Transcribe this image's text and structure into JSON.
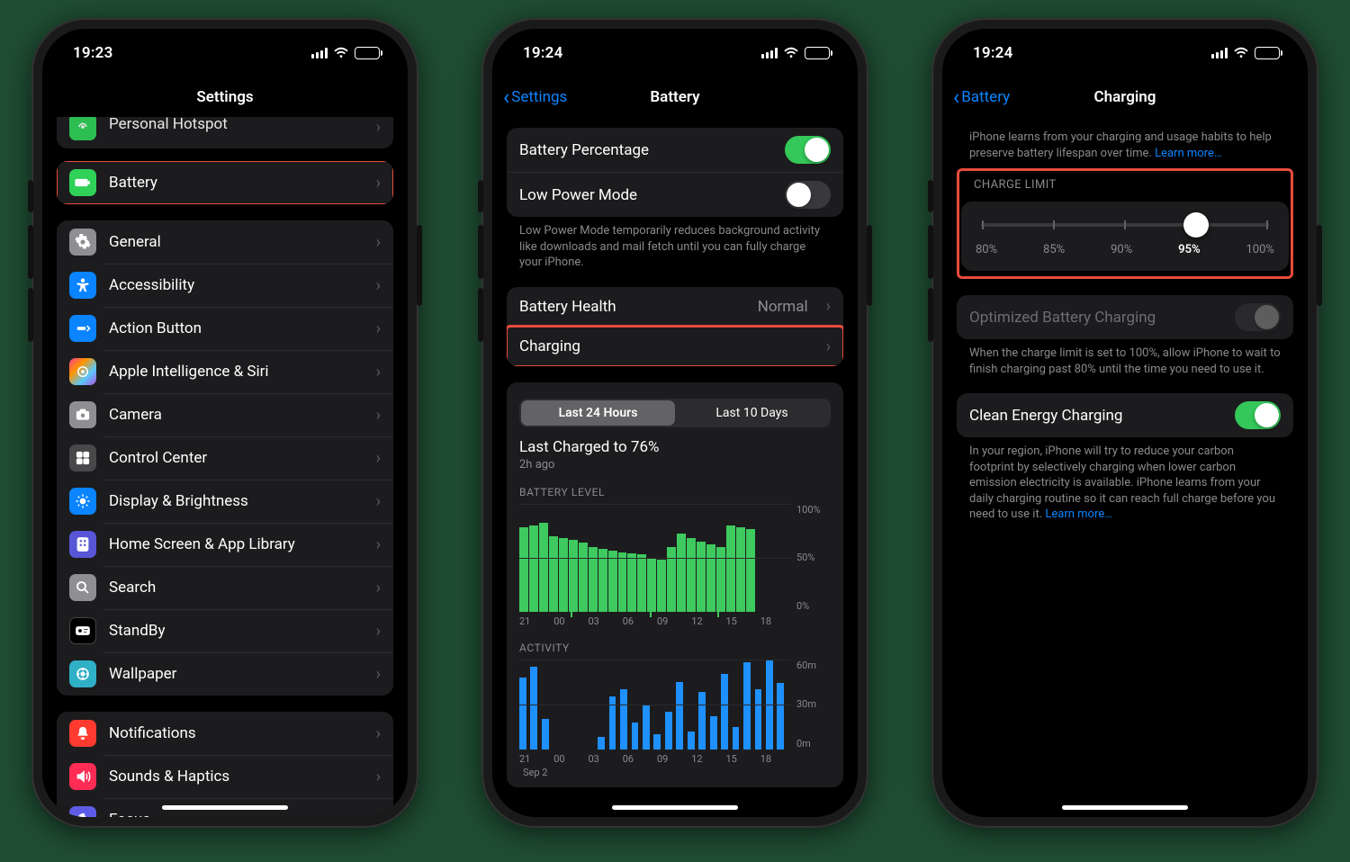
{
  "phones": {
    "p1": {
      "time": "19:23",
      "battery_pct": "63",
      "title": "Settings",
      "group0": [
        {
          "id": "personal-hotspot",
          "label": "Personal Hotspot",
          "iconClass": "ic-hotspot"
        }
      ],
      "group1": [
        {
          "id": "battery",
          "label": "Battery",
          "iconClass": "ic-battery",
          "glyph": "▮▮"
        }
      ],
      "group2": [
        {
          "id": "general",
          "label": "General",
          "iconClass": "ic-gear"
        },
        {
          "id": "accessibility",
          "label": "Accessibility",
          "iconClass": "ic-access"
        },
        {
          "id": "action-button",
          "label": "Action Button",
          "iconClass": "ic-action"
        },
        {
          "id": "apple-intelligence",
          "label": "Apple Intelligence & Siri",
          "iconClass": "ic-ai"
        },
        {
          "id": "camera",
          "label": "Camera",
          "iconClass": "ic-camera"
        },
        {
          "id": "control-center",
          "label": "Control Center",
          "iconClass": "ic-control"
        },
        {
          "id": "display",
          "label": "Display & Brightness",
          "iconClass": "ic-display"
        },
        {
          "id": "home-screen",
          "label": "Home Screen & App Library",
          "iconClass": "ic-home"
        },
        {
          "id": "search",
          "label": "Search",
          "iconClass": "ic-search"
        },
        {
          "id": "standby",
          "label": "StandBy",
          "iconClass": "ic-standby"
        },
        {
          "id": "wallpaper",
          "label": "Wallpaper",
          "iconClass": "ic-wall"
        }
      ],
      "group3": [
        {
          "id": "notifications",
          "label": "Notifications",
          "iconClass": "ic-notif"
        },
        {
          "id": "sounds",
          "label": "Sounds & Haptics",
          "iconClass": "ic-sounds"
        },
        {
          "id": "focus",
          "label": "Focus",
          "iconClass": "ic-focus"
        }
      ]
    },
    "p2": {
      "time": "19:24",
      "battery_pct": "63",
      "back": "Settings",
      "title": "Battery",
      "rows": {
        "battery_percentage": "Battery Percentage",
        "low_power": "Low Power Mode",
        "low_power_footer": "Low Power Mode temporarily reduces background activity like downloads and mail fetch until you can fully charge your iPhone.",
        "battery_health": "Battery Health",
        "battery_health_detail": "Normal",
        "charging": "Charging"
      },
      "segmented": {
        "opt1": "Last 24 Hours",
        "opt2": "Last 10 Days"
      },
      "last_charged_title": "Last Charged to 76%",
      "last_charged_sub": "2h ago",
      "level_title": "BATTERY LEVEL",
      "activity_title": "ACTIVITY",
      "xfoot": "Sep 2"
    },
    "p3": {
      "time": "19:24",
      "battery_pct": "63",
      "back": "Battery",
      "title": "Charging",
      "intro": "iPhone learns from your charging and usage habits to help preserve battery lifespan over time. ",
      "intro_link": "Learn more…",
      "charge_limit_header": "CHARGE LIMIT",
      "slider_labels": [
        "80%",
        "85%",
        "90%",
        "95%",
        "100%"
      ],
      "slider_selected_index": 3,
      "obc_label": "Optimized Battery Charging",
      "obc_footer": "When the charge limit is set to 100%, allow iPhone to wait to finish charging past 80% until the time you need to use it.",
      "cec_label": "Clean Energy Charging",
      "cec_footer": "In your region, iPhone will try to reduce your carbon footprint by selectively charging when lower carbon emission electricity is available. iPhone learns from your daily charging routine so it can reach full charge before you need to use it. ",
      "cec_link": "Learn more…"
    }
  },
  "chart_data": [
    {
      "type": "bar",
      "title": "BATTERY LEVEL",
      "xlabel": "",
      "ylabel": "",
      "ylim": [
        0,
        100
      ],
      "ylabels": [
        "100%",
        "50%",
        "0%"
      ],
      "categories": [
        "21",
        "00",
        "03",
        "06",
        "09",
        "12",
        "15",
        "18"
      ],
      "values": [
        78,
        80,
        82,
        70,
        68,
        66,
        64,
        60,
        58,
        56,
        55,
        54,
        53,
        50,
        48,
        60,
        72,
        68,
        65,
        62,
        60,
        80,
        78,
        76
      ],
      "charge_markers": [
        4,
        11,
        17
      ]
    },
    {
      "type": "bar",
      "title": "ACTIVITY",
      "xlabel": "",
      "ylabel": "minutes",
      "ylim": [
        0,
        60
      ],
      "ylabels": [
        "60m",
        "30m",
        "0m"
      ],
      "categories": [
        "21",
        "00",
        "03",
        "06",
        "09",
        "12",
        "15",
        "18"
      ],
      "values": [
        48,
        55,
        20,
        0,
        0,
        0,
        0,
        8,
        35,
        40,
        18,
        30,
        10,
        25,
        45,
        12,
        38,
        22,
        50,
        15,
        58,
        40,
        60,
        44
      ]
    }
  ]
}
